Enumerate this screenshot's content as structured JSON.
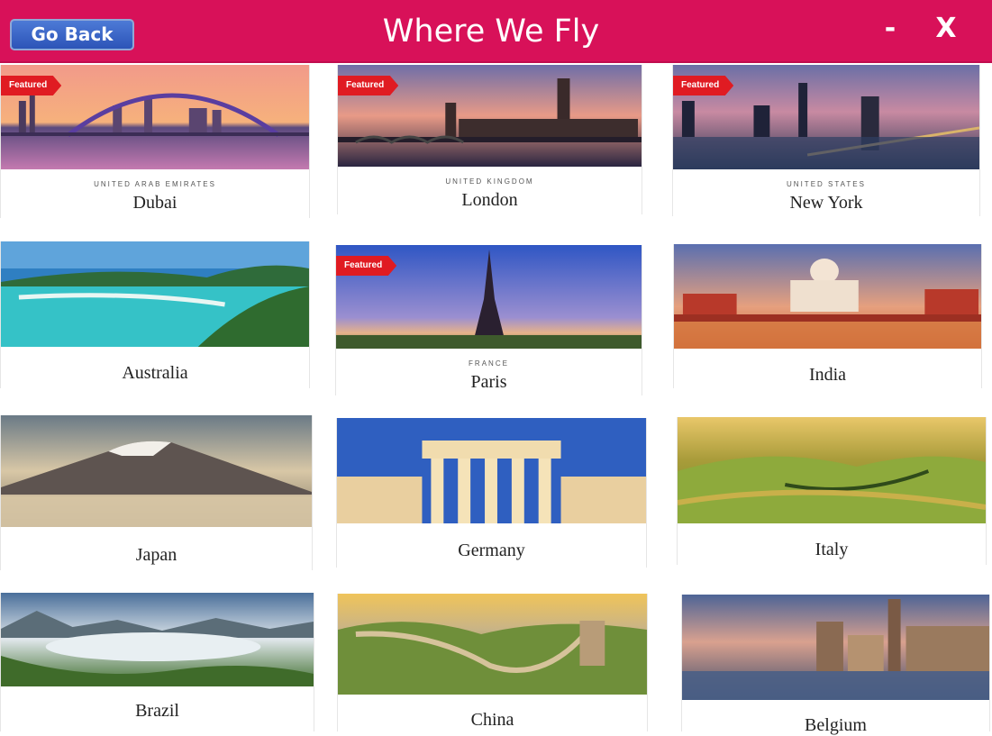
{
  "header": {
    "title": "Where We Fly",
    "back_label": "Go Back",
    "minimize_label": "-",
    "close_label": "X",
    "color": "#d81159"
  },
  "badge_label": "Featured",
  "destinations": [
    {
      "city": "Dubai",
      "country": "UNITED ARAB EMIRATES",
      "featured": true
    },
    {
      "city": "London",
      "country": "UNITED KINGDOM",
      "featured": true
    },
    {
      "city": "New York",
      "country": "UNITED STATES",
      "featured": true
    },
    {
      "city": "Australia",
      "country": "",
      "featured": false
    },
    {
      "city": "Paris",
      "country": "FRANCE",
      "featured": true
    },
    {
      "city": "India",
      "country": "",
      "featured": false
    },
    {
      "city": "Japan",
      "country": "",
      "featured": false
    },
    {
      "city": "Germany",
      "country": "",
      "featured": false
    },
    {
      "city": "Italy",
      "country": "",
      "featured": false
    },
    {
      "city": "Brazil",
      "country": "",
      "featured": false
    },
    {
      "city": "China",
      "country": "",
      "featured": false
    },
    {
      "city": "Belgium",
      "country": "",
      "featured": false
    }
  ]
}
